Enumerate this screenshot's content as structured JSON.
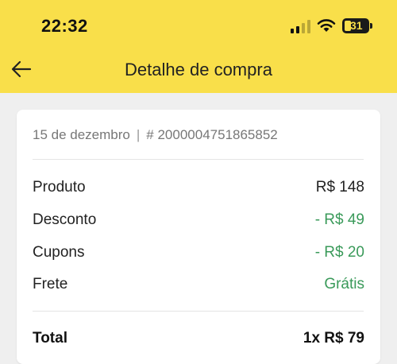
{
  "status_bar": {
    "time": "22:32",
    "battery": "31",
    "signal_icon": "cellular-signal-icon",
    "wifi_icon": "wifi-icon",
    "battery_icon": "battery-icon"
  },
  "header": {
    "title": "Detalhe de compra",
    "back_icon": "arrow-left-icon",
    "background_color": "#f9df4a"
  },
  "order": {
    "date": "15 de dezembro",
    "separator": "|",
    "number": "# 2000004751865852"
  },
  "summary": {
    "product": {
      "label": "Produto",
      "value": "R$ 148"
    },
    "discount": {
      "label": "Desconto",
      "value": "- R$ 49"
    },
    "coupons": {
      "label": "Cupons",
      "value": "- R$ 20"
    },
    "shipping": {
      "label": "Frete",
      "value": "Grátis"
    },
    "total": {
      "label": "Total",
      "value": "1x R$ 79"
    }
  },
  "colors": {
    "accent": "#f9df4a",
    "positive": "#3a9a5a",
    "text": "#222222"
  }
}
